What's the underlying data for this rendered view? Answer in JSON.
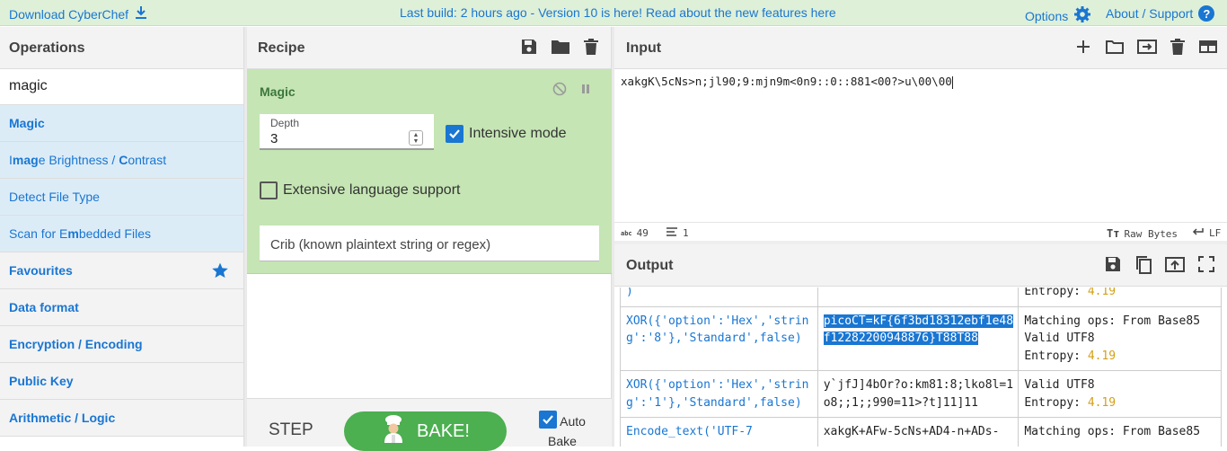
{
  "banner": {
    "download_label": "Download CyberChef",
    "message": "Last build: 2 hours ago - Version 10 is here! Read about the new features ",
    "message_link": "here",
    "options_label": "Options",
    "about_label": "About / Support"
  },
  "operations": {
    "title": "Operations",
    "search_value": "magic",
    "results": [
      {
        "pre": "",
        "hl": "Magic",
        "post": "",
        "hl2": "",
        "post2": ""
      },
      {
        "pre": "I",
        "hl": "mag",
        "post": "e Brightness / ",
        "hl2": "C",
        "post2": "ontrast"
      },
      {
        "pre": "Detect File Type",
        "hl": "",
        "post": "",
        "hl2": "",
        "post2": ""
      },
      {
        "pre": "Scan for E",
        "hl": "m",
        "post": "bedded Files",
        "hl2": "",
        "post2": ""
      }
    ],
    "categories": [
      "Favourites",
      "Data format",
      "Encryption / Encoding",
      "Public Key",
      "Arithmetic / Logic"
    ]
  },
  "recipe": {
    "title": "Recipe",
    "op_name": "Magic",
    "depth_label": "Depth",
    "depth_value": "3",
    "intensive_label": "Intensive mode",
    "intensive_checked": true,
    "extensive_label": "Extensive language support",
    "extensive_checked": false,
    "crib_placeholder": "Crib (known plaintext string or regex)",
    "step_label": "STEP",
    "bake_label": "BAKE!",
    "autobake_label": "Auto Bake",
    "autobake_checked": true
  },
  "input": {
    "title": "Input",
    "value": "xakgK\\5cNs>n;jl90;9:mjn9m<0n9::0::881<00?>u\\00\\00",
    "char_count": "49",
    "line_count": "1",
    "encoding": "Raw Bytes",
    "eol": "LF"
  },
  "output": {
    "title": "Output",
    "rows": [
      {
        "recipe": ")",
        "result": "",
        "result_selected": false,
        "props": "Entropy: ",
        "entropy": "4.19"
      },
      {
        "recipe": "XOR({'option':'Hex','string':'8'},'Standard',false)",
        "result": "picoCT=kF{6f3bd18312ebf1e48f12282200948876}T88T88",
        "result_selected": true,
        "props": "Matching ops: From Base85\nValid UTF8\nEntropy: ",
        "entropy": "4.19"
      },
      {
        "recipe": "XOR({'option':'Hex','string':'1'},'Standard',false)",
        "result": "y`jfJ]4bOr?o:km81:8;lko8l=1o8;;1;;990=11>?t]11]11",
        "result_selected": false,
        "props": "Valid UTF8\nEntropy: ",
        "entropy": "4.19"
      },
      {
        "recipe": "Encode_text('UTF-7",
        "result": "xakgK+AFw-5cNs+AD4-n+ADs-",
        "result_selected": false,
        "props": "Matching ops: From Base85",
        "entropy": ""
      }
    ]
  },
  "colors": {
    "accent": "#1976d2",
    "banner_bg": "#dff0d8",
    "recipe_op_bg": "#c5e5b4",
    "bake_green": "#4caf50",
    "entropy": "#d4a017"
  }
}
